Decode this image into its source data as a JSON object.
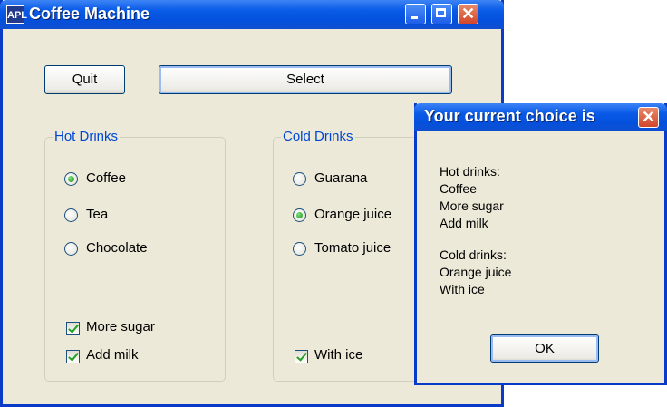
{
  "window": {
    "title": "Coffee Machine",
    "app_icon_text": "APL",
    "controls": {
      "minimize": "minimize-icon",
      "maximize": "maximize-icon",
      "close": "✕"
    }
  },
  "toolbar": {
    "quit_label": "Quit",
    "select_label": "Select"
  },
  "hot_drinks": {
    "legend": "Hot Drinks",
    "options": [
      {
        "label": "Coffee",
        "selected": true
      },
      {
        "label": "Tea",
        "selected": false
      },
      {
        "label": "Chocolate",
        "selected": false
      }
    ],
    "checkboxes": [
      {
        "label": "More sugar",
        "checked": true
      },
      {
        "label": "Add milk",
        "checked": true
      }
    ]
  },
  "cold_drinks": {
    "legend": "Cold Drinks",
    "options": [
      {
        "label": "Guarana",
        "selected": false
      },
      {
        "label": "Orange juice",
        "selected": true
      },
      {
        "label": "Tomato juice",
        "selected": false
      }
    ],
    "checkboxes": [
      {
        "label": "With ice",
        "checked": true
      }
    ]
  },
  "dialog": {
    "title": "Your current choice is",
    "close": "✕",
    "lines": [
      "Hot drinks:",
      "Coffee",
      "More sugar",
      "Add milk",
      "",
      "Cold drinks:",
      "Orange juice",
      "With ice"
    ],
    "ok_label": "OK"
  },
  "colors": {
    "titlebar": "#0a5be8",
    "face": "#ece9d8",
    "legend_text": "#0046d5"
  }
}
